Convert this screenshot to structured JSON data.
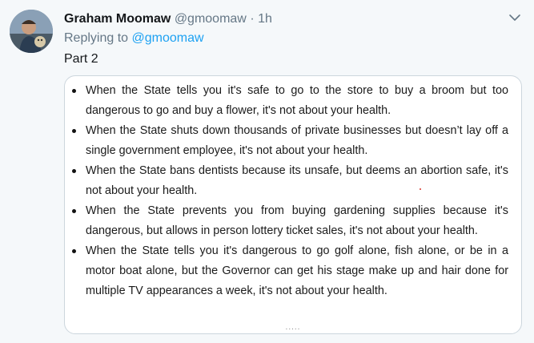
{
  "tweet": {
    "author_name": "Graham Moomaw",
    "author_handle": "@gmoomaw",
    "separator": "·",
    "timestamp": "1h",
    "replying_to_prefix": "Replying to",
    "replying_to_handle": "@gmoomaw",
    "text": "Part 2"
  },
  "image": {
    "bullets": [
      "When the State tells you it's safe to go to the store to buy a broom but too dangerous to go and buy a flower, it's not about your health.",
      "When the State shuts down thousands of private businesses but doesn’t lay off a single government employee, it's not about your health.",
      "When the State bans dentists because its unsafe, but deems an abortion safe, it's not about your health.",
      "When the State prevents you from buying gardening supplies because it's dangerous, but allows in person lottery ticket sales, it's not about your health.",
      "When the State tells you it's dangerous to go golf alone, fish alone, or be in a motor boat alone, but the Governor can get his stage make up and hair done for multiple TV appearances a week, it's not about your health."
    ],
    "continuation": "....."
  },
  "icons": {
    "chevron": "chevron-down-icon",
    "avatar": "avatar"
  },
  "colors": {
    "background": "#f5f8fa",
    "name": "#14171a",
    "secondary": "#657786",
    "link": "#1da1f2",
    "card_border": "#ccd6dd"
  }
}
